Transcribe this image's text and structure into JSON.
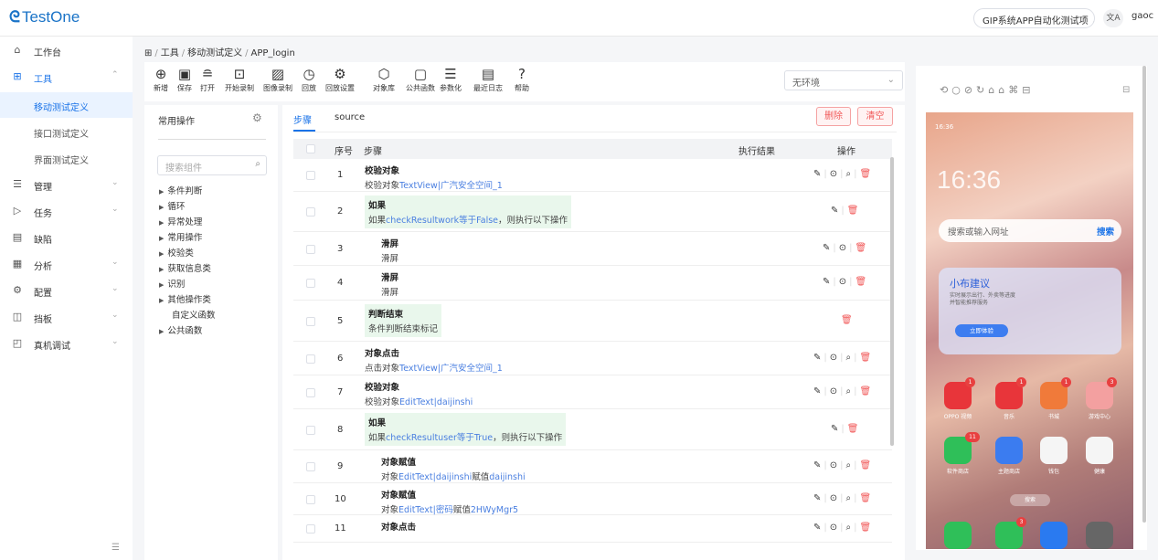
{
  "app": {
    "logo": "TestOne",
    "project": "GIP系统APP自动化测试项",
    "lang_icon": "文A",
    "user": "gaoc"
  },
  "sidebar": {
    "items": [
      {
        "label": "工作台",
        "icon": "home-icon",
        "glyph": "⌂"
      },
      {
        "label": "工具",
        "icon": "grid-icon",
        "glyph": "⊞",
        "expanded": true
      },
      {
        "label": "移动测试定义",
        "sub": true,
        "active": true
      },
      {
        "label": "接口测试定义",
        "sub": true
      },
      {
        "label": "界面测试定义",
        "sub": true
      },
      {
        "label": "管理",
        "icon": "list-icon",
        "glyph": "☰"
      },
      {
        "label": "任务",
        "icon": "send-icon",
        "glyph": "▷"
      },
      {
        "label": "缺陷",
        "icon": "doc-icon",
        "glyph": "▤"
      },
      {
        "label": "分析",
        "icon": "calendar-icon",
        "glyph": "▦"
      },
      {
        "label": "配置",
        "icon": "gear-icon",
        "glyph": "⚙"
      },
      {
        "label": "挡板",
        "icon": "board-icon",
        "glyph": "◫"
      },
      {
        "label": "真机调试",
        "icon": "device-icon",
        "glyph": "◰"
      }
    ],
    "collapse_icon": "☰"
  },
  "breadcrumb": {
    "items": [
      "工具",
      "移动测试定义",
      "APP_login"
    ],
    "separator": "/"
  },
  "toolbar": {
    "items": [
      {
        "label": "新增",
        "glyph": "⊕",
        "icon": "add-icon"
      },
      {
        "label": "保存",
        "glyph": "▣",
        "icon": "save-icon"
      },
      {
        "label": "打开",
        "glyph": "≘",
        "icon": "open-icon"
      },
      {
        "label": "开始录制",
        "glyph": "⊡",
        "icon": "record-icon"
      },
      {
        "label": "图像录制",
        "glyph": "▨",
        "icon": "image-record-icon"
      },
      {
        "label": "回放",
        "glyph": "◷",
        "icon": "replay-icon"
      },
      {
        "label": "回放设置",
        "glyph": "⚙",
        "icon": "replay-settings-icon"
      },
      {
        "label": "对象库",
        "glyph": "⬡",
        "icon": "object-library-icon"
      },
      {
        "label": "公共函数",
        "glyph": "▢",
        "icon": "public-function-icon"
      },
      {
        "label": "参数化",
        "glyph": "☰",
        "icon": "parameterize-icon"
      },
      {
        "label": "最近日志",
        "glyph": "▤",
        "icon": "recent-log-icon"
      },
      {
        "label": "帮助",
        "glyph": "?",
        "icon": "help-icon"
      }
    ],
    "env": "无环境"
  },
  "left_panel": {
    "title": "常用操作",
    "search_placeholder": "搜索组件",
    "tree": [
      {
        "label": "条件判断",
        "arrow": true
      },
      {
        "label": "循环",
        "arrow": true
      },
      {
        "label": "异常处理",
        "arrow": true
      },
      {
        "label": "常用操作",
        "arrow": true
      },
      {
        "label": "校验类",
        "arrow": true
      },
      {
        "label": "获取信息类",
        "arrow": true
      },
      {
        "label": "识别",
        "arrow": true
      },
      {
        "label": "其他操作类",
        "arrow": true
      },
      {
        "label": "自定义函数",
        "arrow": false
      },
      {
        "label": "公共函数",
        "arrow": true
      }
    ]
  },
  "steps": {
    "tabs": [
      "步骤",
      "source"
    ],
    "delete_label": "删除",
    "clear_label": "清空",
    "columns": {
      "index": "序号",
      "step": "步骤",
      "result": "执行结果",
      "ops": "操作"
    },
    "rows": [
      {
        "num": "1",
        "title": "校验对象",
        "desc": [
          {
            "t": "校验对象"
          },
          {
            "t": "TextView|广汽安全空间_1",
            "hl": true
          }
        ],
        "ops": "full",
        "indent": 0,
        "green": false,
        "h": 36
      },
      {
        "num": "2",
        "title": "如果",
        "desc": [
          {
            "t": "如果"
          },
          {
            "t": "checkResultwork等于False",
            "hl": true
          },
          {
            "t": "，则执行以下操作"
          }
        ],
        "ops": "edit-del",
        "indent": 0,
        "green": true,
        "h": 44
      },
      {
        "num": "3",
        "title": "滑屏",
        "desc": [
          {
            "t": "滑屏"
          }
        ],
        "ops": "edit-play-del",
        "indent": 18,
        "green": false,
        "h": 37
      },
      {
        "num": "4",
        "title": "滑屏",
        "desc": [
          {
            "t": "滑屏"
          }
        ],
        "ops": "edit-play-del",
        "indent": 18,
        "green": false,
        "h": 38
      },
      {
        "num": "5",
        "title": "判断结束",
        "desc": [
          {
            "t": "条件判断结束标记"
          }
        ],
        "ops": "del",
        "indent": 0,
        "green": true,
        "h": 45
      },
      {
        "num": "6",
        "title": "对象点击",
        "desc": [
          {
            "t": "点击对象"
          },
          {
            "t": "TextView|广汽安全空间_1",
            "hl": true
          }
        ],
        "ops": "full",
        "indent": 0,
        "green": false,
        "h": 37
      },
      {
        "num": "7",
        "title": "校验对象",
        "desc": [
          {
            "t": "校验对象"
          },
          {
            "t": "EditText|daijinshi",
            "hl": true
          }
        ],
        "ops": "full",
        "indent": 0,
        "green": false,
        "h": 37
      },
      {
        "num": "8",
        "title": "如果",
        "desc": [
          {
            "t": "如果"
          },
          {
            "t": "checkResultuser等于True",
            "hl": true
          },
          {
            "t": "，则执行以下操作"
          }
        ],
        "ops": "edit-del",
        "indent": 0,
        "green": true,
        "h": 45
      },
      {
        "num": "9",
        "title": "对象赋值",
        "desc": [
          {
            "t": "对象"
          },
          {
            "t": "EditText|daijinshi",
            "hl": true
          },
          {
            "t": "赋值"
          },
          {
            "t": "daijinshi",
            "hl": true
          }
        ],
        "ops": "full",
        "indent": 18,
        "green": false,
        "h": 36
      },
      {
        "num": "10",
        "title": "对象赋值",
        "desc": [
          {
            "t": "对象"
          },
          {
            "t": "EditText|密码",
            "hl": true
          },
          {
            "t": "赋值"
          },
          {
            "t": "2HWyMgr5",
            "hl": true
          }
        ],
        "ops": "full",
        "indent": 18,
        "green": false,
        "h": 35
      },
      {
        "num": "11",
        "title": "对象点击",
        "desc": [],
        "ops": "full",
        "indent": 18,
        "green": false,
        "h": 30
      }
    ]
  },
  "phone": {
    "toolbar_icons": "⟲○⊘↻⌂⌂⌘⊟",
    "toolbar_right": "⊟",
    "status": "16:36",
    "clock": "16:36",
    "search_placeholder": "搜索或输入网址",
    "search_btn": "搜索",
    "widget_title": "小布建议",
    "widget_desc": "实时展示出行、外卖等进度\n并智能推荐服务",
    "widget_btn": "立即体验",
    "apps_row1": [
      {
        "label": "OPPO 视频",
        "color": "#e8353a",
        "badge": "1"
      },
      {
        "label": "音乐",
        "color": "#e8353a",
        "badge": "1"
      },
      {
        "label": "书城",
        "color": "#f07a3a",
        "badge": "1"
      },
      {
        "label": "游戏中心",
        "color": "#f3a0a0",
        "badge": "3"
      }
    ],
    "apps_row2": [
      {
        "label": "软件商店",
        "color": "#2fbf59",
        "badge": "11"
      },
      {
        "label": "主题商店",
        "color": "#3b7cf0",
        "badge": ""
      },
      {
        "label": "钱包",
        "color": "#f5f5f5",
        "badge": ""
      },
      {
        "label": "健康",
        "color": "#f5f5f5",
        "badge": ""
      }
    ],
    "dock_search": "搜索",
    "dock": [
      {
        "color": "#2fbf59",
        "badge": ""
      },
      {
        "color": "#2fbf59",
        "badge": "3"
      },
      {
        "color": "#2a7af0",
        "badge": ""
      },
      {
        "color": "#666",
        "badge": ""
      }
    ]
  }
}
